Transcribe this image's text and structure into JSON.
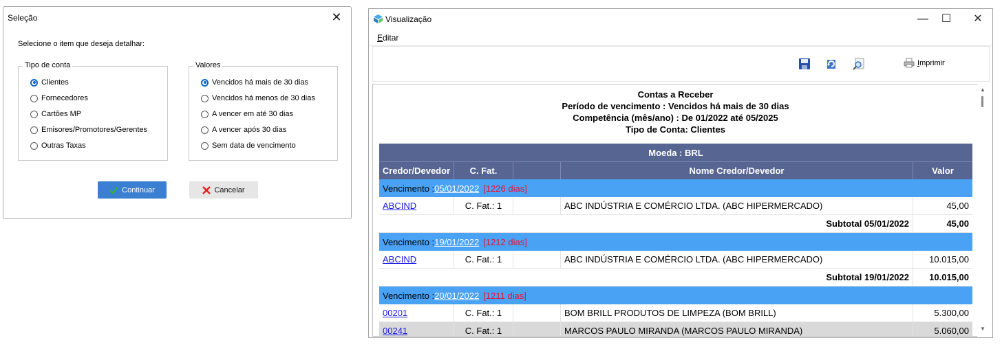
{
  "selection_dialog": {
    "title": "Seleção",
    "close_glyph": "✕",
    "prompt": "Selecione o item que deseja detalhar:",
    "account_group": {
      "label": "Tipo de conta",
      "options": [
        "Clientes",
        "Fornecedores",
        "Cartões MP",
        "Emisores/Promotores/Gerentes",
        "Outras Taxas"
      ],
      "selected": "Clientes"
    },
    "values_group": {
      "label": "Valores",
      "options": [
        "Vencidos há mais de 30 dias",
        "Vencidos há menos de 30 dias",
        "A vencer em até 30 dias",
        "A vencer após 30 dias",
        "Sem data de vencimento"
      ],
      "selected": "Vencidos há mais de 30 dias"
    },
    "continue_label": "Continuar",
    "continue_icon": "check-icon",
    "cancel_label": "Cancelar",
    "cancel_icon": "x-icon"
  },
  "viewer_window": {
    "title": "Visualização",
    "minimize_glyph": "—",
    "maximize_glyph": "☐",
    "close_glyph": "✕",
    "menu": {
      "edit_label": "Editar",
      "edit_mnemonic": "E",
      "edit_rest": "ditar"
    },
    "toolbar": {
      "icons": [
        "save-icon",
        "refresh-icon",
        "zoom-icon"
      ],
      "print_label": "Imprimir",
      "print_mnemonic": "I",
      "print_rest": "mprimir"
    }
  },
  "report": {
    "title": "Contas a Receber",
    "period": "Período de vencimento : Vencidos há mais de 30 dias",
    "competence": "Competência (mês/ano) : De 01/2022 até 05/2025",
    "account_type": "Tipo de Conta: Clientes",
    "currency": "Moeda : BRL",
    "columns": [
      "Credor/Devedor",
      "C. Fat.",
      "",
      "Nome Credor/Devedor",
      "Valor"
    ],
    "groups": [
      {
        "due_prefix": "Vencimento : ",
        "due_date": "05/01/2022",
        "days": "[1226 dias]",
        "rows": [
          {
            "code": "ABCIND",
            "cfat": "C. Fat.: 1",
            "extra": "",
            "name": "ABC INDÚSTRIA E COMÉRCIO LTDA. (ABC HIPERMERCADO)",
            "value": "45,00"
          }
        ],
        "subtotal_label": "Subtotal 05/01/2022",
        "subtotal_value": "45,00"
      },
      {
        "due_prefix": "Vencimento : ",
        "due_date": "19/01/2022",
        "days": "[1212 dias]",
        "rows": [
          {
            "code": "ABCIND",
            "cfat": "C. Fat.: 1",
            "extra": "",
            "name": "ABC INDÚSTRIA E COMÉRCIO LTDA. (ABC HIPERMERCADO)",
            "value": "10.015,00"
          }
        ],
        "subtotal_label": "Subtotal 19/01/2022",
        "subtotal_value": "10.015,00"
      },
      {
        "due_prefix": "Vencimento : ",
        "due_date": "20/01/2022",
        "days": "[1211 dias]",
        "rows": [
          {
            "code": "00201",
            "cfat": "C. Fat.: 1",
            "extra": "",
            "name": "BOM BRILL PRODUTOS DE LIMPEZA (BOM BRILL)",
            "value": "5.300,00"
          },
          {
            "code": "00241",
            "cfat": "C. Fat.: 1",
            "extra": "",
            "name": "MARCOS PAULO MIRANDA (MARCOS PAULO MIRANDA)",
            "value": "5.060,00"
          }
        ]
      }
    ]
  },
  "colors": {
    "header_bg": "#566592",
    "due_row_bg": "#4aa2f5",
    "days_text": "#e8112d",
    "link": "#1a1ae6",
    "primary_button": "#3a7fd1"
  }
}
